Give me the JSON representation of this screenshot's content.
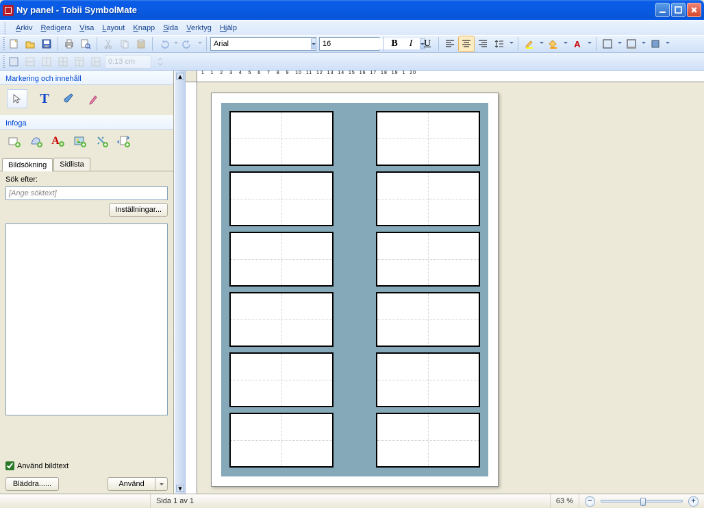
{
  "title": "Ny panel - Tobii SymbolMate",
  "menu": [
    "Arkiv",
    "Redigera",
    "Visa",
    "Layout",
    "Knapp",
    "Sida",
    "Verktyg",
    "Hjälp"
  ],
  "font": {
    "family": "Arial",
    "size": "16"
  },
  "spacing_field": "0.13 cm",
  "left": {
    "section1": "Markering och innehåll",
    "section2": "Infoga",
    "tabs": [
      "Bildsökning",
      "Sidlista"
    ],
    "active_tab": 0,
    "search_label": "Sök efter:",
    "search_placeholder": "[Ange söktext]",
    "settings_btn": "Inställningar...",
    "use_caption": "Använd bildtext",
    "browse_btn": "Bläddra......",
    "apply_btn": "Använd"
  },
  "status": {
    "page": "Sida 1 av 1",
    "zoom": "63 %"
  }
}
